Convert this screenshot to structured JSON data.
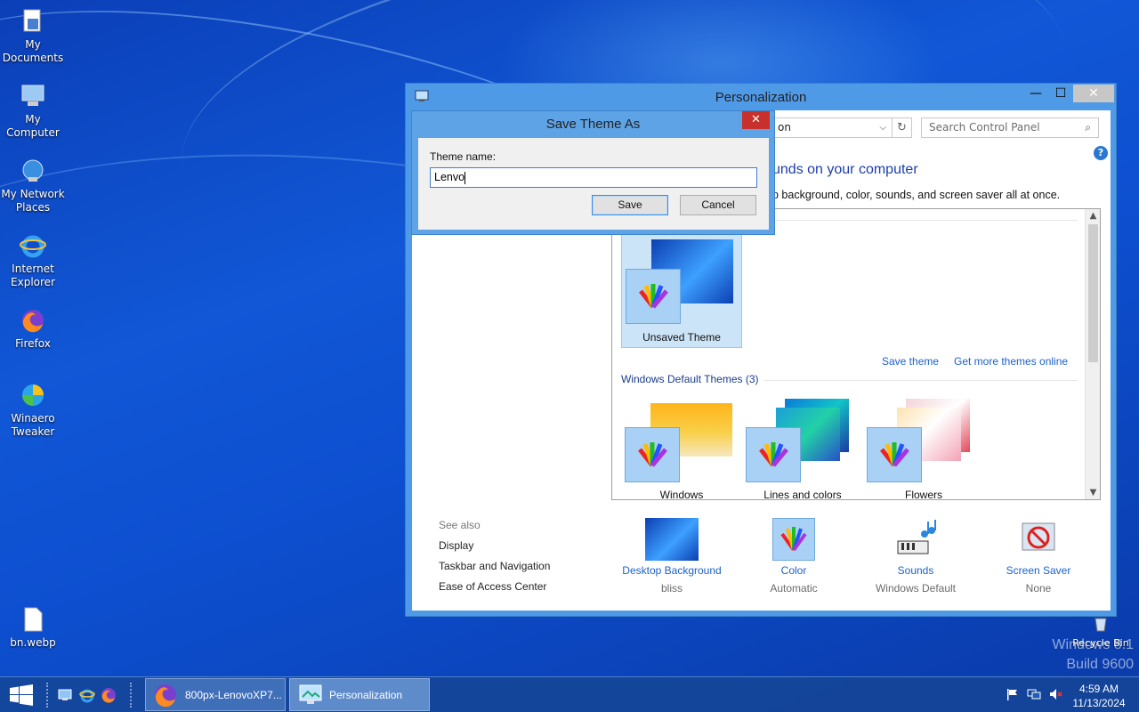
{
  "desktop": {
    "icons": [
      {
        "label": "My Documents",
        "icon": "my-documents-icon"
      },
      {
        "label": "My Computer",
        "icon": "my-computer-icon"
      },
      {
        "label": "My Network Places",
        "icon": "network-places-icon"
      },
      {
        "label": "Internet Explorer",
        "icon": "internet-explorer-icon"
      },
      {
        "label": "Firefox",
        "icon": "firefox-icon"
      },
      {
        "label": "Winaero Tweaker",
        "icon": "winaero-tweaker-icon"
      },
      {
        "label": "bn.webp",
        "icon": "file-icon"
      },
      {
        "label": "Recycle Bin",
        "icon": "recycle-bin-icon"
      }
    ],
    "watermark": {
      "line1": "Windows 8.1",
      "line2": "Build 9600"
    }
  },
  "window": {
    "title": "Personalization",
    "address_text": "on",
    "search_placeholder": "Search Control Panel",
    "help": "?",
    "heading": "unds on your computer",
    "subheading": "p background, color, sounds, and screen saver all at once.",
    "my_theme": {
      "label": "Unsaved Theme"
    },
    "links": {
      "save_theme": "Save theme",
      "get_more": "Get more themes online"
    },
    "default_group": "Windows Default Themes (3)",
    "default_themes": [
      {
        "label": "Windows"
      },
      {
        "label": "Lines and colors"
      },
      {
        "label": "Flowers"
      }
    ],
    "see_also": {
      "heading": "See also",
      "items": [
        "Display",
        "Taskbar and Navigation",
        "Ease of Access Center"
      ]
    },
    "bottom": [
      {
        "label": "Desktop Background",
        "value": "bliss"
      },
      {
        "label": "Color",
        "value": "Automatic"
      },
      {
        "label": "Sounds",
        "value": "Windows Default"
      },
      {
        "label": "Screen Saver",
        "value": "None"
      }
    ]
  },
  "dialog": {
    "title": "Save Theme As",
    "field_label": "Theme name:",
    "field_value": "Lenvo",
    "save": "Save",
    "cancel": "Cancel"
  },
  "taskbar": {
    "buttons": [
      {
        "label": "800px-LenovoXP7...",
        "icon": "firefox-icon"
      },
      {
        "label": "Personalization",
        "icon": "personalization-icon"
      }
    ],
    "clock": {
      "time": "4:59 AM",
      "date": "11/13/2024"
    }
  },
  "colors": {
    "accent": "#1c62c8",
    "close_red": "#c7302b",
    "heading_blue": "#1c3fa6"
  }
}
